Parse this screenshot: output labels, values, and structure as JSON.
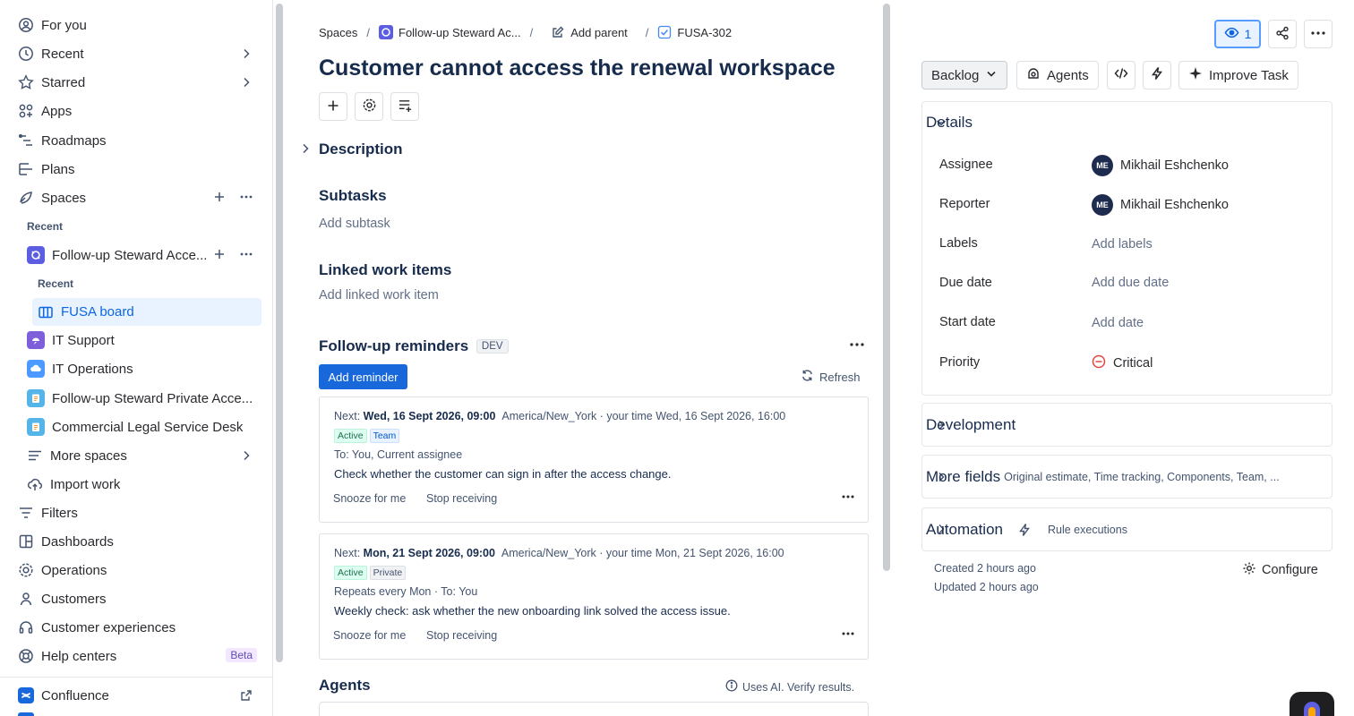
{
  "sidebar": {
    "for_you": "For you",
    "recent": "Recent",
    "starred": "Starred",
    "apps": "Apps",
    "roadmaps": "Roadmaps",
    "plans": "Plans",
    "spaces": "Spaces",
    "recent_heading": "Recent",
    "space_follow_up": "Follow-up Steward Acce...",
    "sub_recent_heading": "Recent",
    "fusa_board": "FUSA board",
    "it_support": "IT Support",
    "it_operations": "IT Operations",
    "follow_up_private": "Follow-up Steward Private Acce...",
    "commercial_legal": "Commercial Legal Service Desk",
    "more_spaces": "More spaces",
    "import_work": "Import work",
    "filters": "Filters",
    "dashboards": "Dashboards",
    "operations": "Operations",
    "customers": "Customers",
    "customer_experiences": "Customer experiences",
    "help_centers": "Help centers",
    "beta": "Beta",
    "confluence": "Confluence"
  },
  "breadcrumb": {
    "spaces": "Spaces",
    "project": "Follow-up Steward Ac...",
    "add_parent": "Add parent",
    "issue_key": "FUSA-302"
  },
  "issue": {
    "title": "Customer cannot access the renewal workspace",
    "description": "Description",
    "subtasks": "Subtasks",
    "add_subtask": "Add subtask",
    "linked": "Linked work items",
    "add_linked": "Add linked work item",
    "reminders": "Follow-up reminders",
    "dev_tag": "DEV",
    "add_reminder": "Add reminder",
    "refresh": "Refresh",
    "agents": "Agents",
    "ai_note": "Uses AI. Verify results."
  },
  "reminders": [
    {
      "next_label": "Next:",
      "next_time": "Wed, 16 Sept 2026, 09:00",
      "zone": "America/New_York · your time Wed, 16 Sept 2026, 16:00",
      "status": "Active",
      "scope": "Team",
      "meta": "To: You, Current assignee",
      "message": "Check whether the customer can sign in after the access change.",
      "snooze": "Snooze for me",
      "stop": "Stop receiving"
    },
    {
      "next_label": "Next:",
      "next_time": "Mon, 21 Sept 2026, 09:00",
      "zone": "America/New_York · your time Mon, 21 Sept 2026, 16:00",
      "status": "Active",
      "scope": "Private",
      "meta": "Repeats every Mon · To: You",
      "message": "Weekly check: ask whether the new onboarding link solved the access issue.",
      "snooze": "Snooze for me",
      "stop": "Stop receiving"
    }
  ],
  "right": {
    "watch_count": "1",
    "status": "Backlog",
    "agents": "Agents",
    "improve": "Improve Task",
    "details": "Details",
    "assignee_label": "Assignee",
    "assignee": "Mikhail Eshchenko",
    "assignee_initials": "ME",
    "reporter_label": "Reporter",
    "reporter": "Mikhail Eshchenko",
    "reporter_initials": "ME",
    "labels_label": "Labels",
    "labels_value": "Add labels",
    "due_label": "Due date",
    "due_value": "Add due date",
    "start_label": "Start date",
    "start_value": "Add date",
    "priority_label": "Priority",
    "priority_value": "Critical",
    "development": "Development",
    "more_fields": "More fields",
    "more_fields_hint": "Original estimate, Time tracking, Components, Team, ...",
    "automation": "Automation",
    "rule_executions": "Rule executions",
    "created": "Created 2 hours ago",
    "updated": "Updated 2 hours ago",
    "configure": "Configure"
  },
  "colors": {
    "accent": "#1868db",
    "active_nav_bg": "#e9f2ff",
    "critical": "#e2483d"
  }
}
